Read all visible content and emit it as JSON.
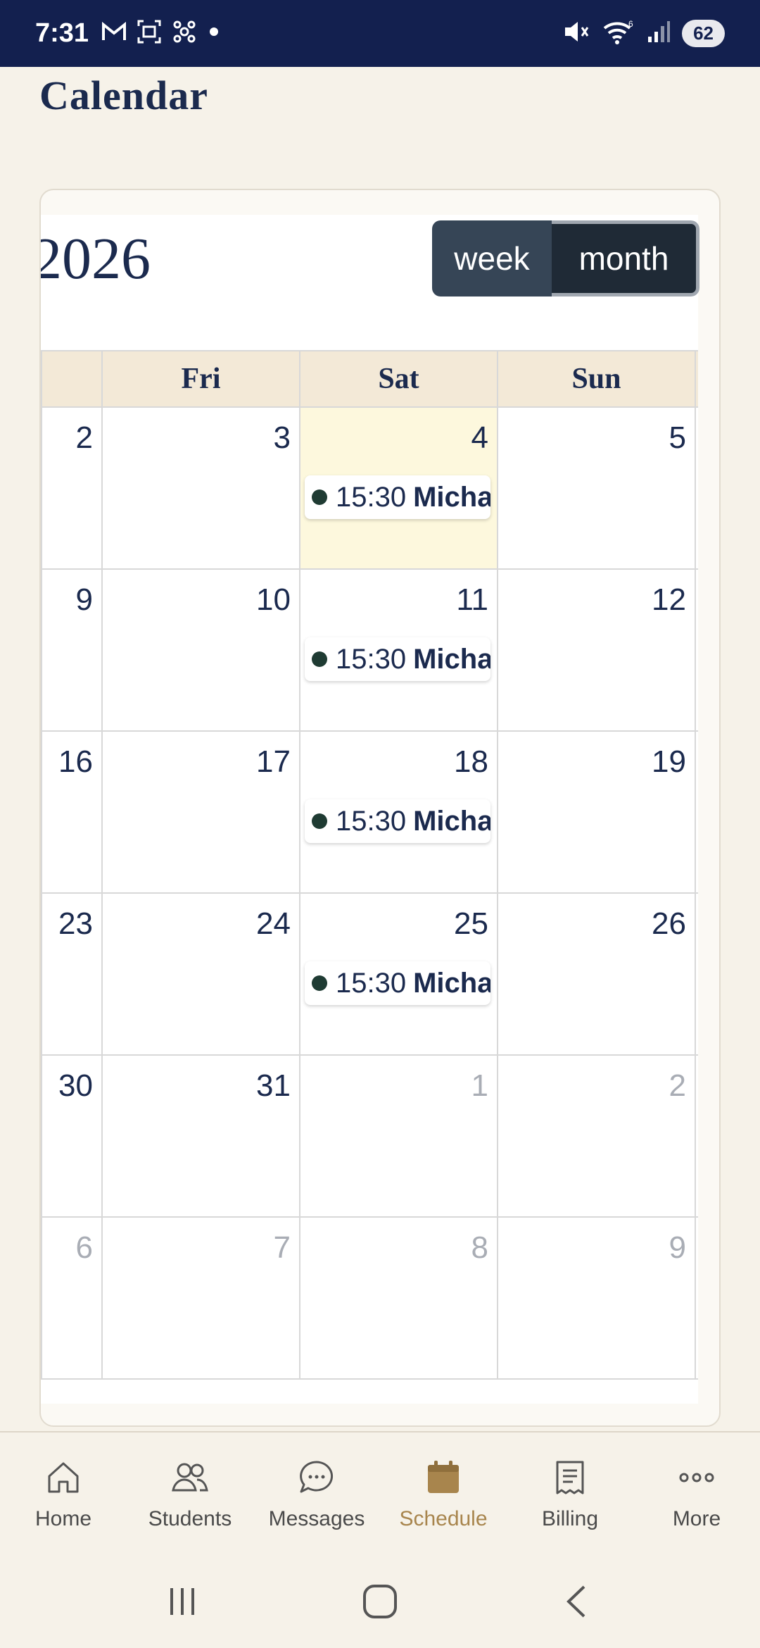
{
  "status_bar": {
    "time": "7:31",
    "battery": "62",
    "wifi_badge": "6"
  },
  "page": {
    "title": "Calendar"
  },
  "calendar": {
    "year_label": "2026",
    "view_toggle": {
      "week": "week",
      "month": "month",
      "selected": "month"
    },
    "headers": [
      "",
      "Fri",
      "Sat",
      "Sun"
    ],
    "weeks": [
      {
        "days": [
          {
            "num": "2"
          },
          {
            "num": "3"
          },
          {
            "num": "4",
            "today": true,
            "event": {
              "time": "15:30",
              "name": "Micha"
            }
          },
          {
            "num": "5"
          }
        ]
      },
      {
        "days": [
          {
            "num": "9"
          },
          {
            "num": "10"
          },
          {
            "num": "11",
            "event": {
              "time": "15:30",
              "name": "Micha"
            }
          },
          {
            "num": "12"
          }
        ]
      },
      {
        "days": [
          {
            "num": "16"
          },
          {
            "num": "17"
          },
          {
            "num": "18",
            "event": {
              "time": "15:30",
              "name": "Micha"
            }
          },
          {
            "num": "19"
          }
        ]
      },
      {
        "days": [
          {
            "num": "23"
          },
          {
            "num": "24"
          },
          {
            "num": "25",
            "event": {
              "time": "15:30",
              "name": "Micha"
            }
          },
          {
            "num": "26"
          }
        ]
      },
      {
        "days": [
          {
            "num": "30"
          },
          {
            "num": "31"
          },
          {
            "num": "1",
            "other": true
          },
          {
            "num": "2",
            "other": true
          }
        ]
      },
      {
        "days": [
          {
            "num": "6",
            "other": true
          },
          {
            "num": "7",
            "other": true
          },
          {
            "num": "8",
            "other": true
          },
          {
            "num": "9",
            "other": true
          }
        ]
      }
    ],
    "event_dot_color": "#1f3b33",
    "today_color": "#fdf8dd"
  },
  "bottom_nav": {
    "items": [
      {
        "label": "Home",
        "icon": "home-icon"
      },
      {
        "label": "Students",
        "icon": "students-icon"
      },
      {
        "label": "Messages",
        "icon": "messages-icon"
      },
      {
        "label": "Schedule",
        "icon": "calendar-icon",
        "active": true
      },
      {
        "label": "Billing",
        "icon": "billing-icon"
      },
      {
        "label": "More",
        "icon": "more-icon"
      }
    ],
    "active_color": "#a8854d"
  }
}
